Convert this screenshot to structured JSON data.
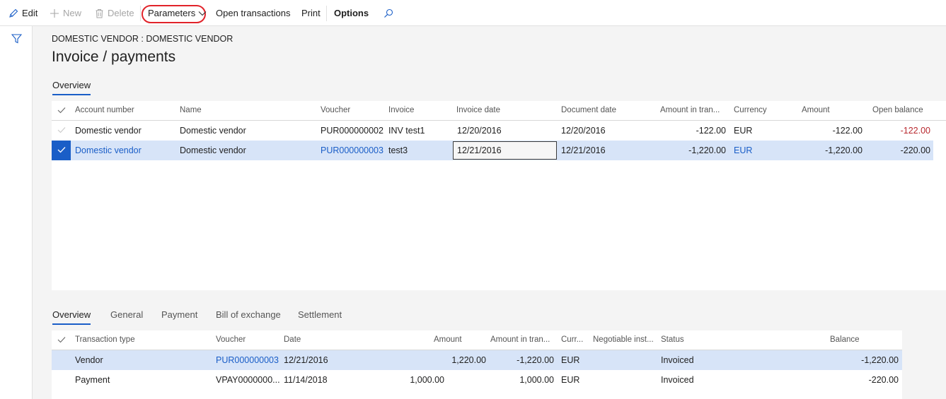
{
  "toolbar": {
    "edit": "Edit",
    "new": "New",
    "delete": "Delete",
    "parameters": "Parameters",
    "open_transactions": "Open transactions",
    "print": "Print",
    "options": "Options"
  },
  "header": {
    "breadcrumb": "DOMESTIC VENDOR : DOMESTIC VENDOR",
    "title": "Invoice / payments"
  },
  "top_tabs": [
    {
      "label": "Overview"
    }
  ],
  "invoice_grid": {
    "columns": [
      "Account number",
      "Name",
      "Voucher",
      "Invoice",
      "Invoice date",
      "Document date",
      "Amount in tran...",
      "Currency",
      "Amount",
      "Open balance"
    ],
    "rows": [
      {
        "account": "Domestic vendor",
        "name": "Domestic vendor",
        "voucher": "PUR000000002",
        "invoice": "INV test1",
        "invoice_date": "12/20/2016",
        "document_date": "12/20/2016",
        "amount_tran": "-122.00",
        "currency": "EUR",
        "amount": "-122.00",
        "open_balance": "-122.00",
        "selected": false
      },
      {
        "account": "Domestic vendor",
        "name": "Domestic vendor",
        "voucher": "PUR000000003",
        "invoice": "test3",
        "invoice_date": "12/21/2016",
        "document_date": "12/21/2016",
        "amount_tran": "-1,220.00",
        "currency": "EUR",
        "amount": "-1,220.00",
        "open_balance": "-220.00",
        "selected": true
      }
    ]
  },
  "bottom_tabs": [
    {
      "label": "Overview"
    },
    {
      "label": "General"
    },
    {
      "label": "Payment"
    },
    {
      "label": "Bill of exchange"
    },
    {
      "label": "Settlement"
    }
  ],
  "trans_grid": {
    "columns": [
      "Transaction type",
      "Voucher",
      "Date",
      "Amount",
      "Amount in tran...",
      "Curr...",
      "Negotiable inst...",
      "Status",
      "Balance"
    ],
    "rows": [
      {
        "type": "Vendor",
        "voucher": "PUR000000003",
        "date": "12/21/2016",
        "amount_a": "",
        "amount": "1,220.00",
        "amount_tran": "-1,220.00",
        "currency": "EUR",
        "status": "Invoiced",
        "balance": "-1,220.00",
        "selected": true
      },
      {
        "type": "Payment",
        "voucher": "VPAY0000000...",
        "date": "11/14/2018",
        "amount_a": "1,000.00",
        "amount": "",
        "amount_tran": "1,000.00",
        "currency": "EUR",
        "status": "Invoiced",
        "balance": "-220.00",
        "selected": false
      }
    ]
  },
  "colors": {
    "accent": "#1a5ec7",
    "selection": "#d7e4f8",
    "negative": "#b8292f",
    "highlight_ring": "#e1232a"
  },
  "icons": [
    "pencil-icon",
    "plus-icon",
    "trash-icon",
    "chevron-down-icon",
    "search-icon",
    "filter-icon",
    "checkmark-icon"
  ]
}
